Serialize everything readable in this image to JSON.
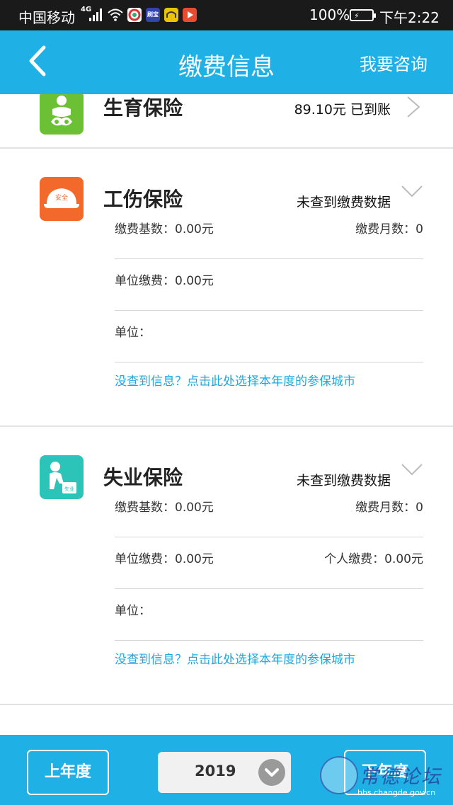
{
  "status_bar": {
    "carrier": "中国移动",
    "network": "4G",
    "app_icons": [
      "browser-icon",
      "weibo-icon",
      "app-icon",
      "video-icon"
    ],
    "app_icon_labels": [
      "",
      "",
      "刷宝",
      ""
    ],
    "battery": "100%",
    "time": "下午2:22"
  },
  "nav": {
    "title": "缴费信息",
    "consult_label": "我要咨询",
    "accent_color": "#1fb0e6"
  },
  "sections": [
    {
      "name": "生育保险",
      "status": "89.10元 已到账",
      "icon": "baby-icon",
      "icon_color": "#6cc033"
    },
    {
      "name": "工伤保险",
      "status": "未查到缴费数据",
      "icon": "helmet-icon",
      "icon_text": "安全",
      "icon_color": "#f2692b",
      "rows": [
        {
          "left": "缴费基数：0.00元",
          "right": "缴费月数：0"
        },
        {
          "left": "单位缴费：0.00元",
          "right": ""
        },
        {
          "left": "单位：",
          "right": ""
        }
      ],
      "link": "没查到信息？点击此处选择本年度的参保城市"
    },
    {
      "name": "失业保险",
      "status": "未查到缴费数据",
      "icon": "unemployed-icon",
      "icon_text": "失业",
      "icon_color": "#2cc3b8",
      "rows": [
        {
          "left": "缴费基数：0.00元",
          "right": "缴费月数：0"
        },
        {
          "left": "单位缴费：0.00元",
          "right": "个人缴费：0.00元"
        },
        {
          "left": "单位：",
          "right": ""
        }
      ],
      "link": "没查到信息？点击此处选择本年度的参保城市"
    }
  ],
  "bottom": {
    "prev_label": "上年度",
    "year": "2019",
    "next_label": "下年度",
    "watermark_text": "常德论坛",
    "watermark_url": "bbs.changde.gov.cn"
  }
}
